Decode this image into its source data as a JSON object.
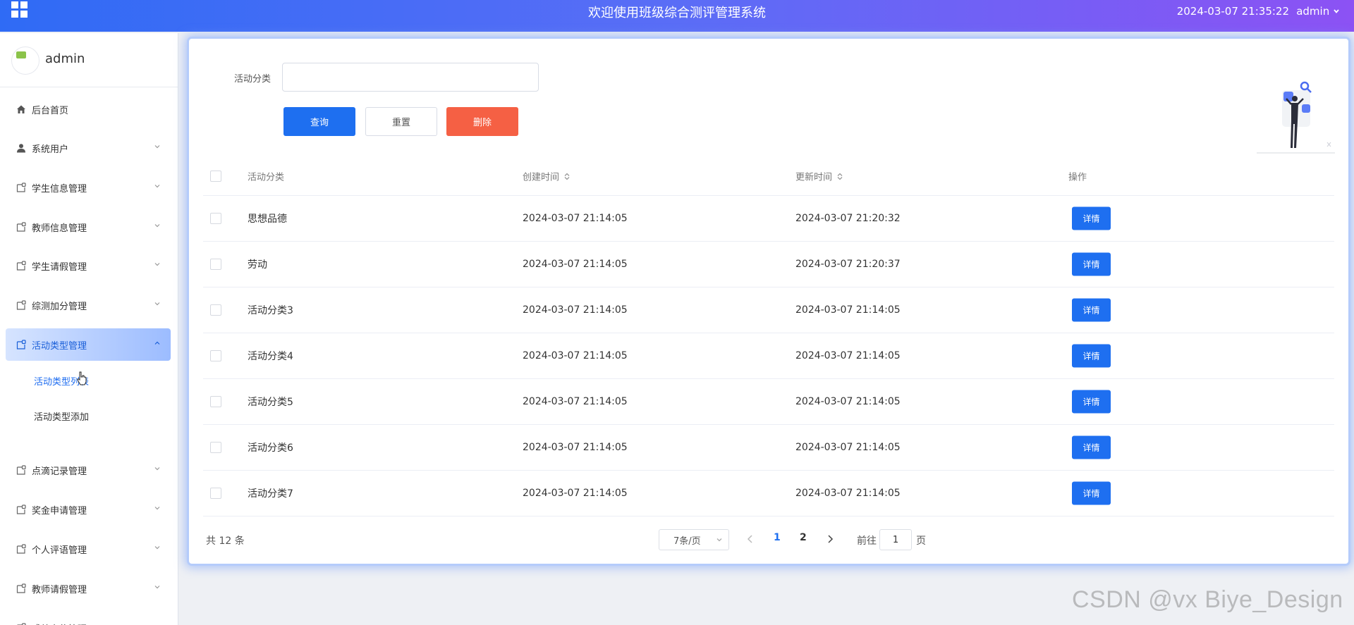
{
  "header": {
    "title": "欢迎使用班级综合测评管理系统",
    "datetime": "2024-03-07 21:35:22",
    "user": "admin"
  },
  "sidebar": {
    "username": "admin",
    "items": [
      {
        "label": "后台首页",
        "icon": "home-icon"
      },
      {
        "label": "系统用户",
        "icon": "user-icon"
      },
      {
        "label": "学生信息管理",
        "icon": "module-icon"
      },
      {
        "label": "教师信息管理",
        "icon": "module-icon"
      },
      {
        "label": "学生请假管理",
        "icon": "module-icon"
      },
      {
        "label": "综测加分管理",
        "icon": "module-icon"
      },
      {
        "label": "活动类型管理",
        "icon": "module-icon",
        "active": true
      },
      {
        "label": "点滴记录管理",
        "icon": "module-icon"
      },
      {
        "label": "奖金申请管理",
        "icon": "module-icon"
      },
      {
        "label": "个人评语管理",
        "icon": "module-icon"
      },
      {
        "label": "教师请假管理",
        "icon": "module-icon"
      },
      {
        "label": "成绩上传管理",
        "icon": "module-icon"
      }
    ],
    "submenu": [
      {
        "label": "活动类型列表",
        "active": true
      },
      {
        "label": "活动类型添加"
      }
    ]
  },
  "search": {
    "label": "活动分类",
    "value": "",
    "placeholder": "",
    "query_label": "查询",
    "reset_label": "重置",
    "delete_label": "删除"
  },
  "table": {
    "columns": [
      "活动分类",
      "创建时间",
      "更新时间",
      "操作"
    ],
    "detail_label": "详情",
    "rows": [
      {
        "category": "思想品德",
        "created": "2024-03-07 21:14:05",
        "updated": "2024-03-07 21:20:32"
      },
      {
        "category": "劳动",
        "created": "2024-03-07 21:14:05",
        "updated": "2024-03-07 21:20:37"
      },
      {
        "category": "活动分类3",
        "created": "2024-03-07 21:14:05",
        "updated": "2024-03-07 21:14:05"
      },
      {
        "category": "活动分类4",
        "created": "2024-03-07 21:14:05",
        "updated": "2024-03-07 21:14:05"
      },
      {
        "category": "活动分类5",
        "created": "2024-03-07 21:14:05",
        "updated": "2024-03-07 21:14:05"
      },
      {
        "category": "活动分类6",
        "created": "2024-03-07 21:14:05",
        "updated": "2024-03-07 21:14:05"
      },
      {
        "category": "活动分类7",
        "created": "2024-03-07 21:14:05",
        "updated": "2024-03-07 21:14:05"
      }
    ]
  },
  "pagination": {
    "total": "共 12 条",
    "page_size": "7条/页",
    "pages": [
      "1",
      "2"
    ],
    "current_page": "1",
    "goto_label": "前往",
    "goto_value": "1",
    "goto_suffix": "页"
  },
  "watermark": "CSDN @vx  Biye_Design",
  "colors": {
    "primary": "#1e6ff0",
    "danger": "#f56044",
    "header_gradient_start": "#2f6bf5",
    "header_gradient_end": "#8c52f4"
  }
}
